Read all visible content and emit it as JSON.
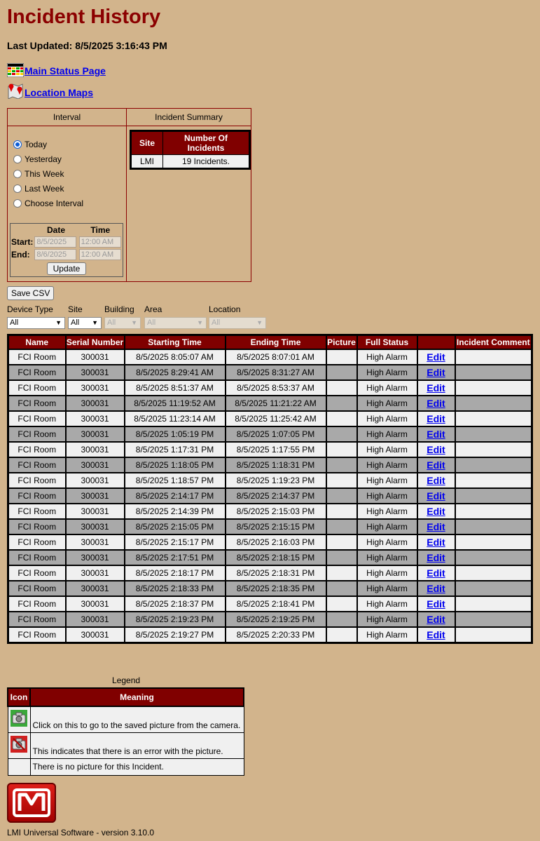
{
  "page": {
    "title": "Incident History",
    "last_updated": "Last Updated: 8/5/2025 3:16:43 PM"
  },
  "nav": {
    "main_status": "Main Status Page",
    "location_maps": "Location Maps"
  },
  "interval": {
    "header": "Interval",
    "options": [
      "Today",
      "Yesterday",
      "This Week",
      "Last Week",
      "Choose Interval"
    ],
    "selected": "Today",
    "date_header": "Date",
    "time_header": "Time",
    "start_label": "Start:",
    "end_label": "End:",
    "start_date": "8/5/2025",
    "start_time": "12:00 AM",
    "end_date": "8/6/2025",
    "end_time": "12:00 AM",
    "update_button": "Update"
  },
  "summary": {
    "header": "Incident Summary",
    "col_site": "Site",
    "col_count": "Number Of Incidents",
    "site": "LMI",
    "count": "19 Incidents."
  },
  "save_csv": "Save CSV",
  "filters": {
    "device_type": {
      "label": "Device Type",
      "value": "All"
    },
    "site": {
      "label": "Site",
      "value": "All"
    },
    "building": {
      "label": "Building",
      "value": "All"
    },
    "area": {
      "label": "Area",
      "value": "All"
    },
    "location": {
      "label": "Location",
      "value": "All"
    }
  },
  "table": {
    "headers": [
      "Name",
      "Serial Number",
      "Starting Time",
      "Ending Time",
      "Picture",
      "Full Status",
      "",
      "Incident Comment"
    ],
    "edit_label": "Edit",
    "rows": [
      [
        "FCI Room",
        "300031",
        "8/5/2025 8:05:07 AM",
        "8/5/2025 8:07:01 AM",
        "",
        "High Alarm"
      ],
      [
        "FCI Room",
        "300031",
        "8/5/2025 8:29:41 AM",
        "8/5/2025 8:31:27 AM",
        "",
        "High Alarm"
      ],
      [
        "FCI Room",
        "300031",
        "8/5/2025 8:51:37 AM",
        "8/5/2025 8:53:37 AM",
        "",
        "High Alarm"
      ],
      [
        "FCI Room",
        "300031",
        "8/5/2025 11:19:52 AM",
        "8/5/2025 11:21:22 AM",
        "",
        "High Alarm"
      ],
      [
        "FCI Room",
        "300031",
        "8/5/2025 11:23:14 AM",
        "8/5/2025 11:25:42 AM",
        "",
        "High Alarm"
      ],
      [
        "FCI Room",
        "300031",
        "8/5/2025 1:05:19 PM",
        "8/5/2025 1:07:05 PM",
        "",
        "High Alarm"
      ],
      [
        "FCI Room",
        "300031",
        "8/5/2025 1:17:31 PM",
        "8/5/2025 1:17:55 PM",
        "",
        "High Alarm"
      ],
      [
        "FCI Room",
        "300031",
        "8/5/2025 1:18:05 PM",
        "8/5/2025 1:18:31 PM",
        "",
        "High Alarm"
      ],
      [
        "FCI Room",
        "300031",
        "8/5/2025 1:18:57 PM",
        "8/5/2025 1:19:23 PM",
        "",
        "High Alarm"
      ],
      [
        "FCI Room",
        "300031",
        "8/5/2025 2:14:17 PM",
        "8/5/2025 2:14:37 PM",
        "",
        "High Alarm"
      ],
      [
        "FCI Room",
        "300031",
        "8/5/2025 2:14:39 PM",
        "8/5/2025 2:15:03 PM",
        "",
        "High Alarm"
      ],
      [
        "FCI Room",
        "300031",
        "8/5/2025 2:15:05 PM",
        "8/5/2025 2:15:15 PM",
        "",
        "High Alarm"
      ],
      [
        "FCI Room",
        "300031",
        "8/5/2025 2:15:17 PM",
        "8/5/2025 2:16:03 PM",
        "",
        "High Alarm"
      ],
      [
        "FCI Room",
        "300031",
        "8/5/2025 2:17:51 PM",
        "8/5/2025 2:18:15 PM",
        "",
        "High Alarm"
      ],
      [
        "FCI Room",
        "300031",
        "8/5/2025 2:18:17 PM",
        "8/5/2025 2:18:31 PM",
        "",
        "High Alarm"
      ],
      [
        "FCI Room",
        "300031",
        "8/5/2025 2:18:33 PM",
        "8/5/2025 2:18:35 PM",
        "",
        "High Alarm"
      ],
      [
        "FCI Room",
        "300031",
        "8/5/2025 2:18:37 PM",
        "8/5/2025 2:18:41 PM",
        "",
        "High Alarm"
      ],
      [
        "FCI Room",
        "300031",
        "8/5/2025 2:19:23 PM",
        "8/5/2025 2:19:25 PM",
        "",
        "High Alarm"
      ],
      [
        "FCI Room",
        "300031",
        "8/5/2025 2:19:27 PM",
        "8/5/2025 2:20:33 PM",
        "",
        "High Alarm"
      ]
    ]
  },
  "legend": {
    "title": "Legend",
    "col_icon": "Icon",
    "col_meaning": "Meaning",
    "rows": [
      {
        "icon": "camera-ok-icon",
        "meaning": "Click on this to go to the saved picture from the camera."
      },
      {
        "icon": "camera-error-icon",
        "meaning": "This indicates that there is an error with the picture."
      },
      {
        "icon": "",
        "meaning": "There is no picture for this Incident."
      }
    ]
  },
  "colors": {
    "background": "#d2b48c",
    "header_red": "#800000",
    "title_red": "#8b0000",
    "row_light": "#f0f0f0",
    "row_dark": "#a9a9a9",
    "link_blue": "#0000ee"
  },
  "footer": {
    "logo_icon": "lmi-logo-icon",
    "version": "LMI Universal Software - version 3.10.0"
  }
}
